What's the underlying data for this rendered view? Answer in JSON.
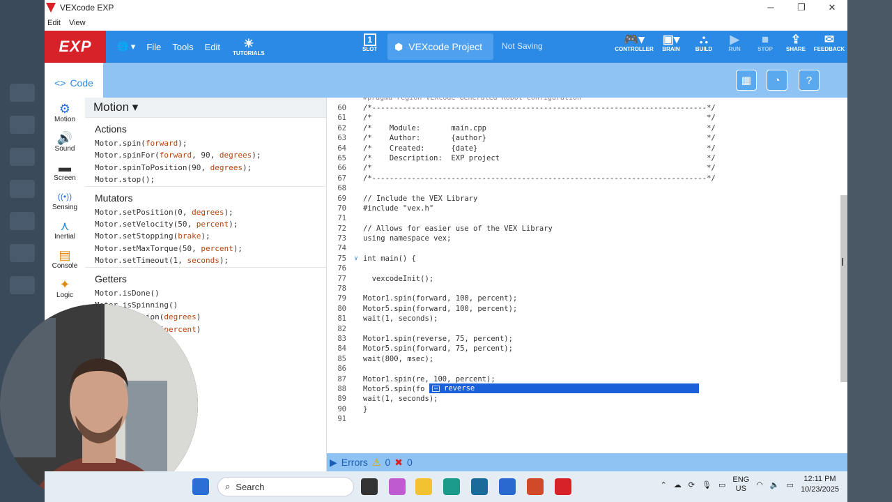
{
  "window": {
    "title": "VEXcode EXP",
    "min": "─",
    "max": "❐",
    "close": "✕"
  },
  "menubar": {
    "items": [
      "Edit",
      "View"
    ]
  },
  "toolbar": {
    "brand": "EXP",
    "globe": "🌐 ▾",
    "file": "File",
    "tools": "Tools",
    "edit": "Edit",
    "tutorials": "TUTORIALS",
    "slot_num": "1",
    "slot": "SLOT",
    "project_name": "VEXcode Project",
    "saving": "Not Saving",
    "controller": "CONTROLLER",
    "brain": "BRAIN",
    "build": "BUILD",
    "run": "RUN",
    "stop": "STOP",
    "share": "SHARE",
    "feedback": "FEEDBACK"
  },
  "code_tab": {
    "label": "Code",
    "icon": "<>"
  },
  "categories": [
    {
      "label": "Motion",
      "icon": "⚙"
    },
    {
      "label": "Sound",
      "icon": "🔊"
    },
    {
      "label": "Screen",
      "icon": "▬"
    },
    {
      "label": "Sensing",
      "icon": "((•))"
    },
    {
      "label": "Inertial",
      "icon": "⋏"
    },
    {
      "label": "Console",
      "icon": "▤"
    },
    {
      "label": "Logic",
      "icon": "✦"
    }
  ],
  "palette": {
    "title": "Motion ▾",
    "actions_title": "Actions",
    "actions": [
      [
        "Motor.spin(",
        "forward",
        ");"
      ],
      [
        "Motor.spinFor(",
        "forward",
        ", 90, ",
        "degrees",
        ");"
      ],
      [
        "Motor.spinToPosition(90, ",
        "degrees",
        ");"
      ],
      [
        "Motor.stop();"
      ]
    ],
    "mutators_title": "Mutators",
    "mutators": [
      [
        "Motor.setPosition(0, ",
        "degrees",
        ");"
      ],
      [
        "Motor.setVelocity(50, ",
        "percent",
        ");"
      ],
      [
        "Motor.setStopping(",
        "brake",
        ");"
      ],
      [
        "Motor.setMaxTorque(50, ",
        "percent",
        ");"
      ],
      [
        "Motor.setTimeout(1, ",
        "seconds",
        ");"
      ]
    ],
    "getters_title": "Getters",
    "getters": [
      [
        "Motor.isDone()"
      ],
      [
        "Motor.isSpinning()"
      ],
      [
        "Motor.position(",
        "degrees",
        ")"
      ],
      [
        "Motor.velocity(",
        "percent",
        ")"
      ]
    ]
  },
  "editor": {
    "header": "#pragma region VEXcode Generated Robot Configuration",
    "lines": [
      {
        "n": "60",
        "t": "/*----------------------------------------------------------------------------*/",
        "c": "cm"
      },
      {
        "n": "61",
        "t": "/*                                                                            */",
        "c": "cm"
      },
      {
        "n": "62",
        "t": "/*    Module:       main.cpp                                                  */",
        "c": "cm"
      },
      {
        "n": "63",
        "t": "/*    Author:       {author}                                                  */",
        "c": "cm"
      },
      {
        "n": "64",
        "t": "/*    Created:      {date}                                                    */",
        "c": "cm"
      },
      {
        "n": "65",
        "t": "/*    Description:  EXP project                                               */",
        "c": "cm"
      },
      {
        "n": "66",
        "t": "/*                                                                            */",
        "c": "cm"
      },
      {
        "n": "67",
        "t": "/*----------------------------------------------------------------------------*/",
        "c": "cm"
      },
      {
        "n": "68",
        "t": "",
        "c": ""
      },
      {
        "n": "69",
        "t": "// Include the VEX Library",
        "c": "cm"
      },
      {
        "n": "70",
        "t": "#include \"vex.h\"",
        "c": "str"
      },
      {
        "n": "71",
        "t": "",
        "c": ""
      },
      {
        "n": "72",
        "t": "// Allows for easier use of the VEX Library",
        "c": "cm"
      },
      {
        "n": "73",
        "t": "using namespace vex;",
        "c": "kw"
      },
      {
        "n": "74",
        "t": "",
        "c": ""
      },
      {
        "n": "75",
        "t": "int main() {",
        "c": "kw",
        "fold": "∨"
      },
      {
        "n": "76",
        "t": "",
        "c": ""
      },
      {
        "n": "77",
        "t": "  vexcodeInit();",
        "c": ""
      },
      {
        "n": "78",
        "t": "",
        "c": ""
      },
      {
        "n": "79",
        "t": "Motor1.spin(forward, 100, percent);",
        "c": ""
      },
      {
        "n": "80",
        "t": "Motor5.spin(forward, 100, percent);",
        "c": ""
      },
      {
        "n": "81",
        "t": "wait(1, seconds);",
        "c": ""
      },
      {
        "n": "82",
        "t": "",
        "c": ""
      },
      {
        "n": "83",
        "t": "Motor1.spin(reverse, 75, percent);",
        "c": ""
      },
      {
        "n": "84",
        "t": "Motor5.spin(forward, 75, percent);",
        "c": ""
      },
      {
        "n": "85",
        "t": "wait(800, msec);",
        "c": ""
      },
      {
        "n": "86",
        "t": "",
        "c": ""
      },
      {
        "n": "87",
        "t": "Motor1.spin(re, 100, percent);",
        "c": ""
      },
      {
        "n": "88",
        "t": "Motor5.spin(fo",
        "c": ""
      },
      {
        "n": "89",
        "t": "wait(1, seconds);",
        "c": ""
      },
      {
        "n": "90",
        "t": "}",
        "c": ""
      },
      {
        "n": "91",
        "t": "",
        "c": ""
      }
    ],
    "autocomplete": "reverse"
  },
  "errors": {
    "label": "Errors",
    "warn_icon": "⚠",
    "warnings": "0",
    "err_icon": "✖",
    "errors": "0"
  },
  "taskbar": {
    "search": "Search",
    "lang_top": "ENG",
    "lang_bottom": "US",
    "time": "12:11 PM",
    "date": "10/23/2025"
  },
  "colors": {
    "brand_red": "#d8222a",
    "toolbar_blue": "#2b8ae6",
    "light_blue": "#8fc3f3"
  }
}
